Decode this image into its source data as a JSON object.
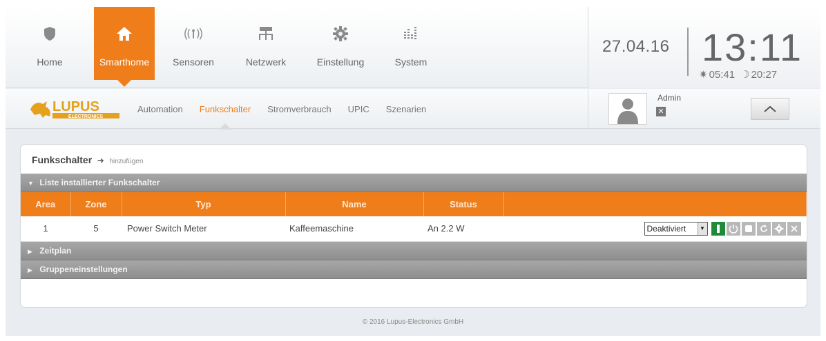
{
  "nav": {
    "items": [
      {
        "label": "Home",
        "icon": "shield-icon"
      },
      {
        "label": "Smarthome",
        "icon": "house-icon",
        "active": true
      },
      {
        "label": "Sensoren",
        "icon": "radio-waves-icon"
      },
      {
        "label": "Netzwerk",
        "icon": "network-icon"
      },
      {
        "label": "Einstellung",
        "icon": "gear-icon"
      },
      {
        "label": "System",
        "icon": "bar-chart-icon"
      }
    ]
  },
  "clock": {
    "date": "27.04.16",
    "time": "13:11",
    "sunrise": "05:41",
    "sunset": "20:27"
  },
  "brand": {
    "logo": "LUPUS",
    "logo_sub": "ELECTRONICS"
  },
  "subnav": {
    "items": [
      {
        "label": "Automation"
      },
      {
        "label": "Funkschalter",
        "active": true
      },
      {
        "label": "Stromverbrauch"
      },
      {
        "label": "UPIC"
      },
      {
        "label": "Szenarien"
      }
    ]
  },
  "user": {
    "name": "Admin"
  },
  "panel": {
    "title": "Funkschalter",
    "add_link": "hinzufügen",
    "sections": {
      "list": "Liste installierter Funkschalter",
      "schedule": "Zeitplan",
      "group": "Gruppeneinstellungen"
    },
    "table": {
      "headers": [
        "Area",
        "Zone",
        "Typ",
        "Name",
        "Status"
      ],
      "rows": [
        {
          "area": "1",
          "zone": "5",
          "typ": "Power Switch Meter",
          "name": "Kaffeemaschine",
          "status": "An 2.2 W",
          "mode": "Deaktiviert"
        }
      ]
    }
  },
  "footer": "© 2016 Lupus-Electronics GmbH",
  "colors": {
    "accent": "#ef7d1a",
    "section": "#999999",
    "on_button": "#1f8a3a"
  }
}
